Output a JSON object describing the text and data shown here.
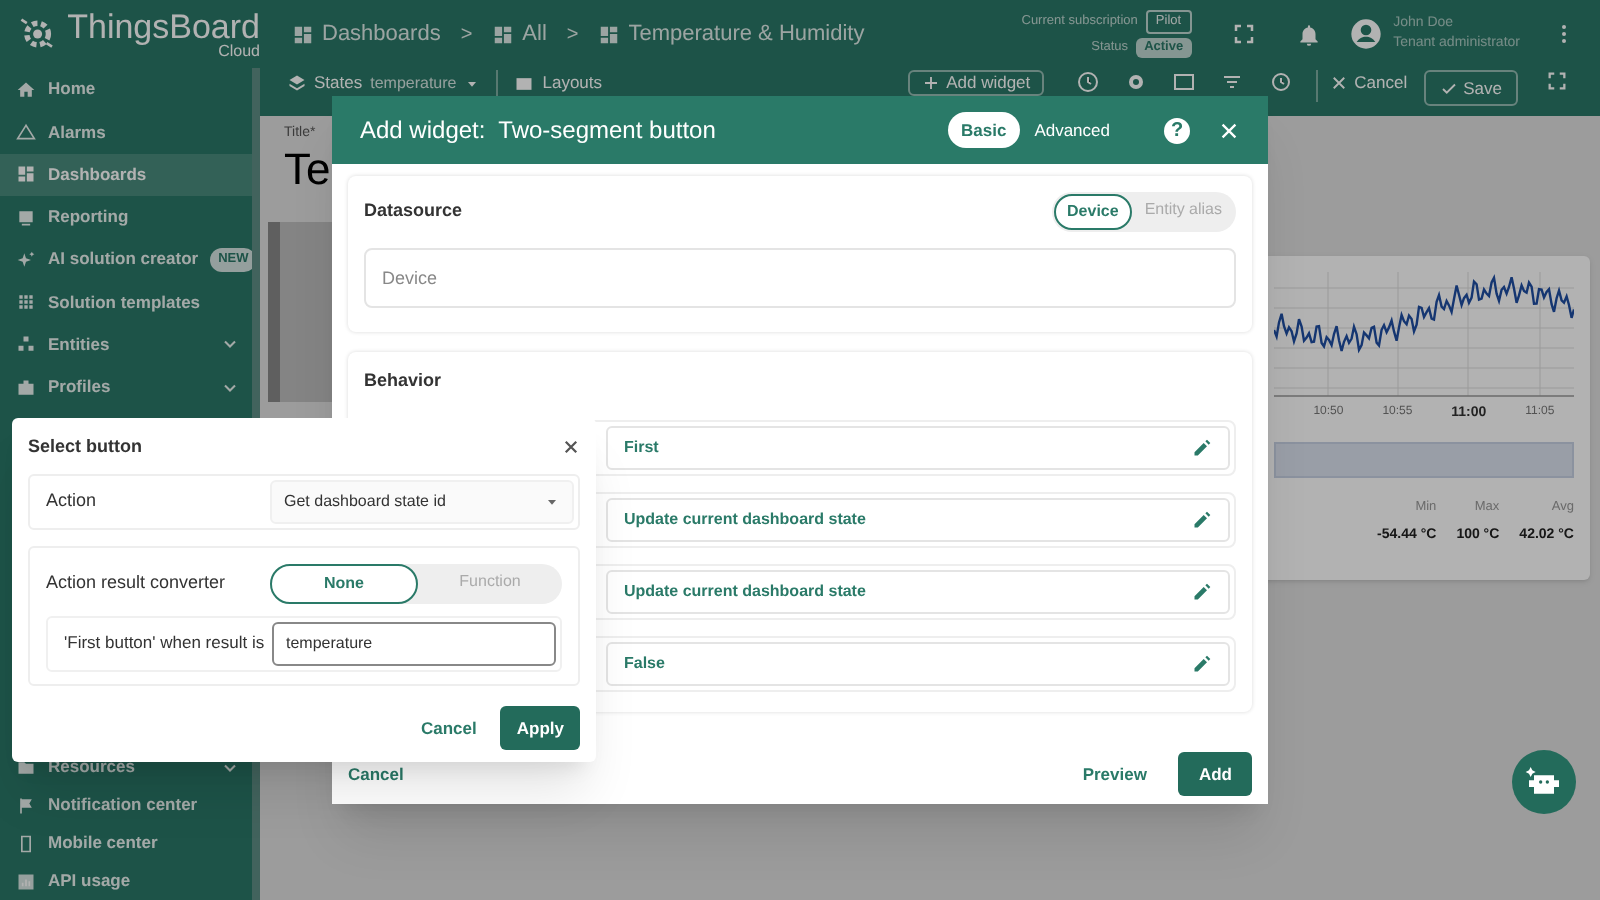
{
  "header": {
    "logo": "ThingsBoard",
    "logo_sub": "Cloud",
    "breadcrumbs": [
      {
        "label": "Dashboards",
        "separator_after": ">"
      },
      {
        "label": "All",
        "separator_after": ">"
      },
      {
        "label": "Temperature & Humidity"
      }
    ],
    "subscription": {
      "label": "Current subscription",
      "plan": "Pilot",
      "status_label": "Status",
      "status": "Active"
    },
    "user": {
      "name": "John Doe",
      "role": "Tenant administrator"
    }
  },
  "sidebar": {
    "items": [
      {
        "label": "Home",
        "selected": false,
        "expandable": false
      },
      {
        "label": "Alarms",
        "selected": false,
        "expandable": false
      },
      {
        "label": "Dashboards",
        "selected": true,
        "expandable": false
      },
      {
        "label": "Reporting",
        "selected": false,
        "expandable": false
      },
      {
        "label": "AI solution creator",
        "selected": false,
        "expandable": false,
        "badge": "NEW"
      },
      {
        "label": "Solution templates",
        "selected": false,
        "expandable": false
      },
      {
        "label": "Entities",
        "selected": false,
        "expandable": true
      },
      {
        "label": "Profiles",
        "selected": false,
        "expandable": true
      }
    ],
    "lower_items": [
      {
        "label": "Resources",
        "selected": false,
        "expandable": true
      },
      {
        "label": "Notification center",
        "selected": false,
        "expandable": false
      },
      {
        "label": "Mobile center",
        "selected": false,
        "expandable": false
      },
      {
        "label": "API usage",
        "selected": false,
        "expandable": false
      }
    ]
  },
  "toolbar": {
    "states_label": "States",
    "state": "temperature",
    "layouts": "Layouts",
    "add_widget": "Add widget",
    "cancel": "Cancel",
    "save": "Save"
  },
  "dashboard": {
    "title_label": "Title*",
    "title": "Te",
    "chart": {
      "x_ticks": [
        {
          "label": "10:50",
          "major": false
        },
        {
          "label": "10:55",
          "major": false
        },
        {
          "label": "11:00",
          "major": true
        },
        {
          "label": "11:05",
          "major": false
        }
      ],
      "stats": [
        {
          "label": "Min",
          "value": "-54.44 °C"
        },
        {
          "label": "Max",
          "value": "100 °C"
        },
        {
          "label": "Avg",
          "value": "42.02 °C"
        }
      ]
    }
  },
  "add_widget_dialog": {
    "title": "Add widget:  Two-segment button",
    "help_glyph": "?",
    "modes": [
      {
        "label": "Basic",
        "selected": true
      },
      {
        "label": "Advanced",
        "selected": false
      }
    ],
    "datasource": {
      "title": "Datasource",
      "types": [
        {
          "label": "Device",
          "selected": true
        },
        {
          "label": "Entity alias",
          "selected": false
        }
      ],
      "placeholder": "Device"
    },
    "behavior": {
      "title": "Behavior",
      "rows": [
        {
          "value": "First"
        },
        {
          "value": "Update current dashboard state"
        },
        {
          "value": "Update current dashboard state"
        },
        {
          "value": "False"
        }
      ]
    },
    "cancel": "Cancel",
    "preview": "Preview",
    "add": "Add"
  },
  "select_button_popover": {
    "title": "Select button",
    "action_label": "Action",
    "action_value": "Get dashboard state id",
    "converter_label": "Action result converter",
    "converter_options": [
      {
        "label": "None",
        "selected": true
      },
      {
        "label": "Function",
        "selected": false
      }
    ],
    "result_label": "'First button' when result is",
    "result_value": "temperature",
    "cancel": "Cancel",
    "apply": "Apply"
  }
}
